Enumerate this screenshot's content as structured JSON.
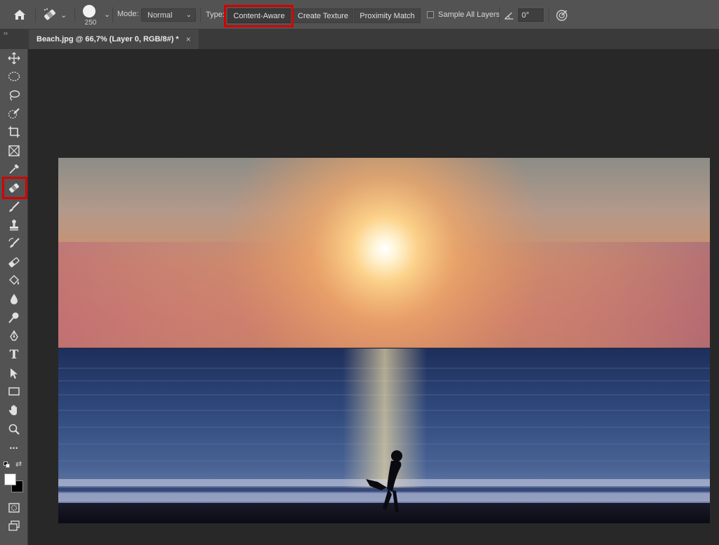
{
  "options_bar": {
    "mode_label": "Mode:",
    "mode_value": "Normal",
    "brush_size": "250",
    "type_label": "Type:",
    "type_options": [
      "Content-Aware",
      "Create Texture",
      "Proximity Match"
    ],
    "type_selected": "Content-Aware",
    "sample_all_layers_label": "Sample All Layers",
    "sample_all_layers_checked": false,
    "angle_value": "0°"
  },
  "document_tab": {
    "title": "Beach.jpg @ 66,7% (Layer 0, RGB/8#) *",
    "close_glyph": "×"
  },
  "toolbar": {
    "collapse_glyph": "››",
    "selected_tool": "spot-healing-brush-tool",
    "tools": [
      "move-tool",
      "marquee-tool",
      "lasso-tool",
      "quick-selection-tool",
      "crop-tool",
      "frame-tool",
      "eyedropper-tool",
      "spot-healing-brush-tool",
      "brush-tool",
      "clone-stamp-tool",
      "history-brush-tool",
      "eraser-tool",
      "paint-bucket-tool",
      "blur-tool",
      "dodge-tool",
      "pen-tool",
      "type-tool",
      "path-selection-tool",
      "rectangle-tool",
      "hand-tool",
      "zoom-tool",
      "edit-toolbar"
    ],
    "type_tool_glyph": "T",
    "more_glyph": "•••"
  },
  "colors": {
    "foreground": "#ffffff",
    "background": "#000000",
    "highlight": "#d40000",
    "ui_panel": "#535353"
  }
}
